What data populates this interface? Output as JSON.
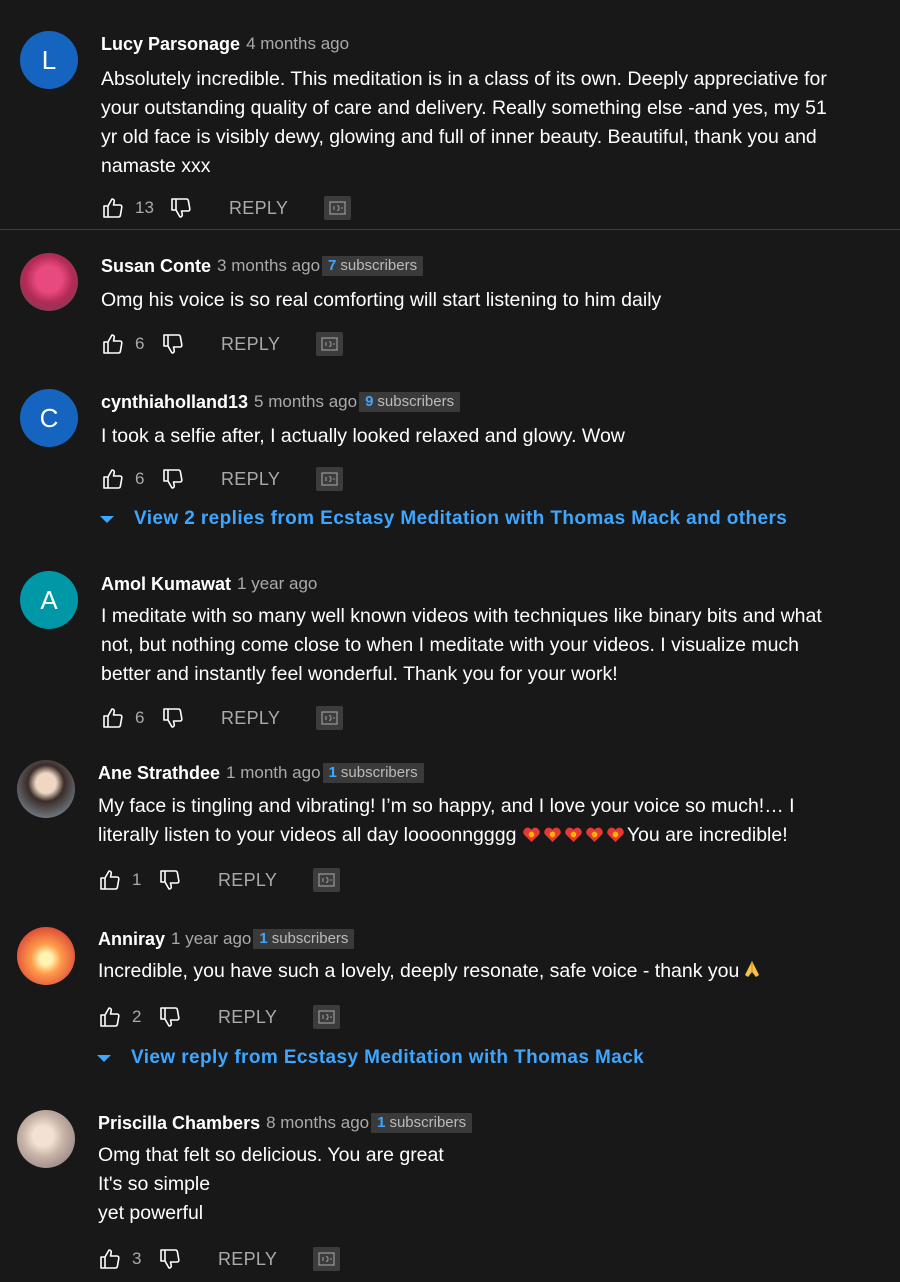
{
  "comments": [
    {
      "author": "Lucy Parsonage",
      "time": "4 months ago",
      "avatar_letter": "L",
      "avatar_color": "#1565c0",
      "text": "Absolutely incredible. This meditation is in a class of its own. Deeply appreciative for\nyour  outstanding quality of care and delivery. Really something else -and yes, my 51\nyr old face is visibly dewy, glowing and full of inner beauty. Beautiful, thank you and\nnamaste xxx",
      "likes": "13",
      "reply_label": "REPLY"
    },
    {
      "author": "Susan Conte",
      "time": "3 months ago",
      "subscribers_count": "7",
      "subscribers_label": "subscribers",
      "text": "Omg his voice is so real comforting will start listening to him daily",
      "likes": "6",
      "reply_label": "REPLY"
    },
    {
      "author": "cynthiaholland13",
      "time": "5 months ago",
      "avatar_letter": "C",
      "avatar_color": "#1565c0",
      "subscribers_count": "9",
      "subscribers_label": "subscribers",
      "text": "I took a selfie after,  I actually looked relaxed and glowy. Wow",
      "likes": "6",
      "reply_label": "REPLY",
      "replies_label": "View 2 replies from Ecstasy Meditation with Thomas Mack and others"
    },
    {
      "author": "Amol Kumawat",
      "time": "1 year ago",
      "avatar_letter": "A",
      "avatar_color": "#0097a7",
      "text": "I meditate with so many well known videos with techniques like binary bits and what\nnot, but nothing come close to when I meditate with your videos. I visualize much\nbetter and instantly feel wonderful. Thank you for your work!",
      "likes": "6",
      "reply_label": "REPLY"
    },
    {
      "author": "Ane Strathdee",
      "time": "1 month ago",
      "subscribers_count": "1",
      "subscribers_label": "subscribers",
      "text_line1": "My face is tingling and vibrating! I’m so happy, and I love your voice so much!… I",
      "text_line2_start": "literally listen to your videos all day loooonngggg ",
      "text_line2_end": "You are incredible!",
      "likes": "1",
      "reply_label": "REPLY"
    },
    {
      "author": "Anniray",
      "time": "1 year ago",
      "subscribers_count": "1",
      "subscribers_label": "subscribers",
      "text": "Incredible, you have such a lovely, deeply resonate, safe voice - thank you",
      "likes": "2",
      "reply_label": "REPLY",
      "replies_label": "View reply from Ecstasy Meditation with Thomas Mack"
    },
    {
      "author": "Priscilla Chambers",
      "time": "8 months ago",
      "subscribers_count": "1",
      "subscribers_label": "subscribers",
      "text": "Omg that felt so delicious.  You are great\nIt's so simple\nyet powerful",
      "likes": "3",
      "reply_label": "REPLY"
    }
  ],
  "colors": {
    "background": "#181818",
    "link_blue": "#3ea6ff",
    "meta_gray": "#aaaaaa"
  }
}
